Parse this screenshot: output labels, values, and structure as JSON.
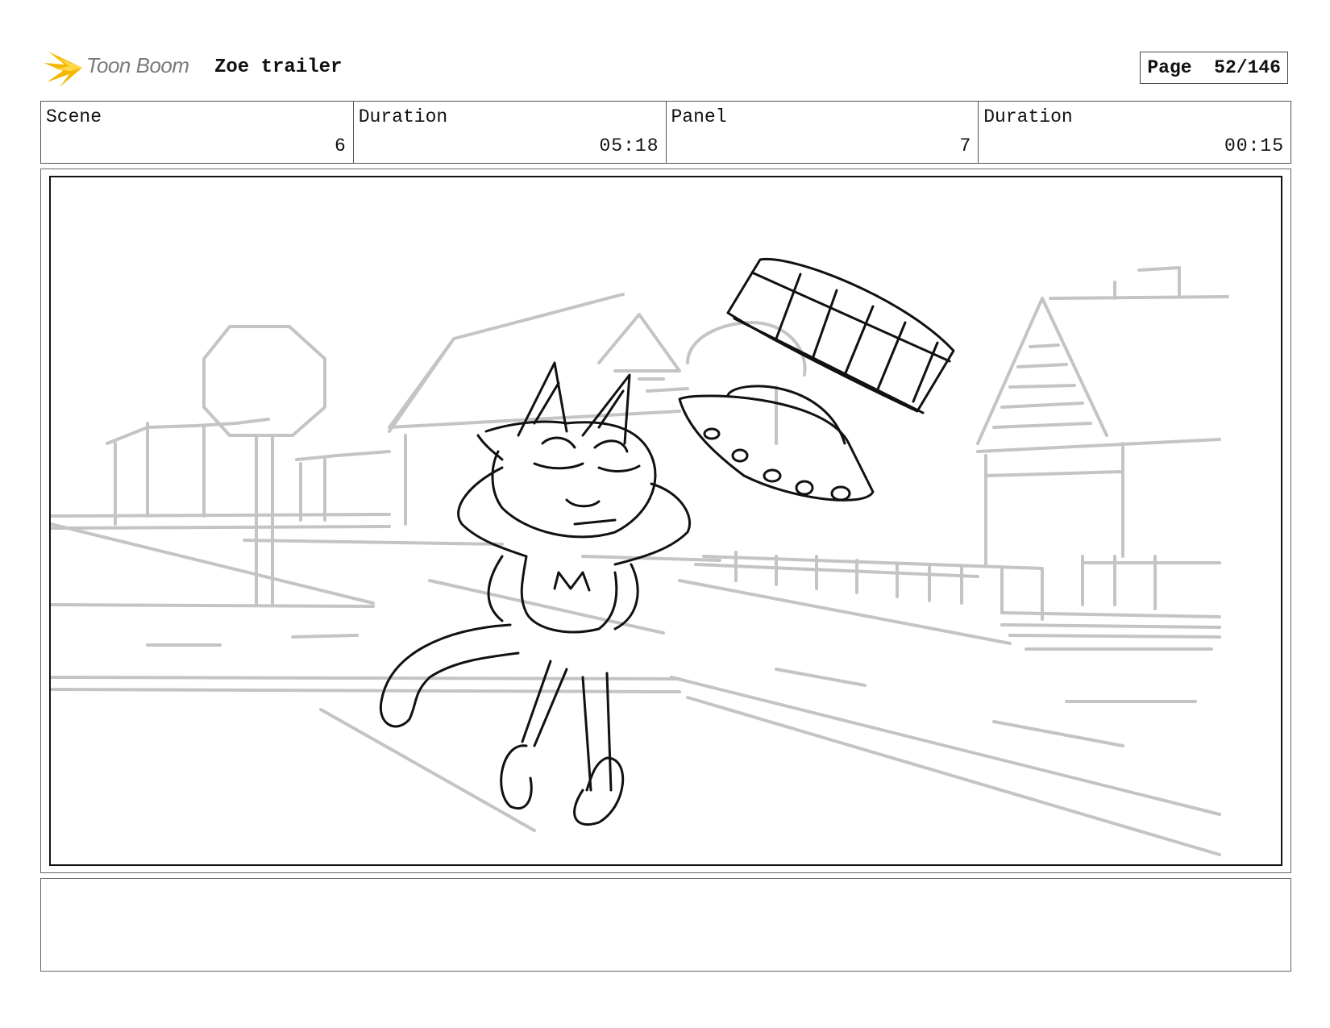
{
  "header": {
    "logo_text": "Toon Boom",
    "title": "Zoe trailer",
    "page_label": "Page",
    "page_value": "52/146"
  },
  "info": {
    "scene_label": "Scene",
    "scene_value": "6",
    "scene_duration_label": "Duration",
    "scene_duration_value": "05:18",
    "panel_label": "Panel",
    "panel_value": "7",
    "panel_duration_label": "Duration",
    "panel_duration_value": "00:15"
  },
  "colors": {
    "logo_accent": "#f5b800",
    "background_sketch": "#c4c4c4",
    "character_sketch": "#111111"
  },
  "notes": {
    "text": ""
  }
}
